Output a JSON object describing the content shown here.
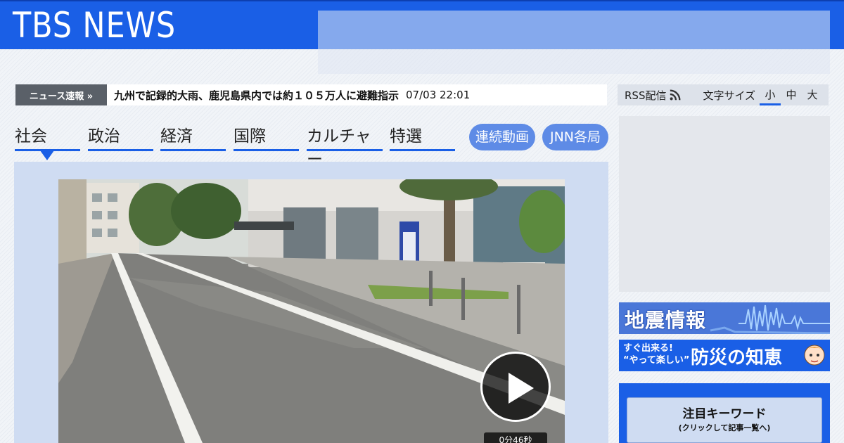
{
  "header": {
    "logo": "TBS NEWS"
  },
  "breaking": {
    "label": "ニュース速報 »",
    "headline": "九州で記録的大雨、鹿児島県内では約１０５万人に避難指示",
    "time": "07/03 22:01"
  },
  "utility": {
    "rss_label": "RSS配信",
    "font_size_label": "文字サイズ",
    "font_sizes": [
      "小",
      "中",
      "大"
    ],
    "font_size_selected": "小"
  },
  "nav": {
    "tabs": [
      "社会",
      "政治",
      "経済",
      "国際",
      "カルチャー",
      "特選"
    ],
    "active_tab": "社会",
    "pills": [
      "連続動画",
      "JNN各局"
    ]
  },
  "video": {
    "duration": "0分46秒",
    "play_icon": "play-icon"
  },
  "sidebar": {
    "earthquake_banner": "地震情報",
    "bousai_small_line1": "すぐ出来る!",
    "bousai_small_line2": "“やって楽しい”",
    "bousai_big": "防災の知恵",
    "keyword_title": "注目キーワード",
    "keyword_sub": "(クリックして記事一覧へ)"
  },
  "colors": {
    "brand_blue": "#1a5fe6",
    "pill_blue": "#5e8be6",
    "panel_blue": "#cfdcf2",
    "breaking_label_bg": "#5a6068"
  }
}
